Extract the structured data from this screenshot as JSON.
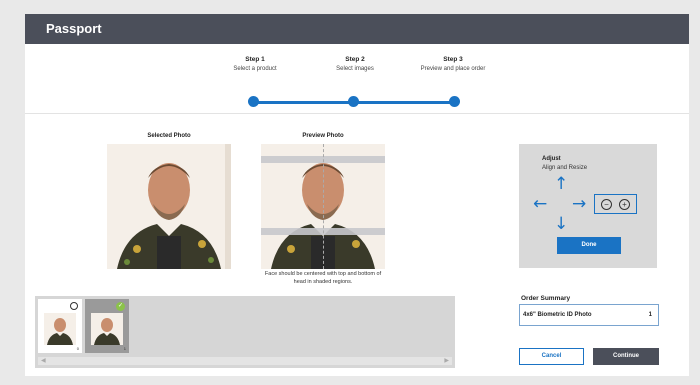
{
  "header": {
    "title": "Passport"
  },
  "steps": [
    {
      "number": "Step 1",
      "description": "Select a product"
    },
    {
      "number": "Step 2",
      "description": "Select images"
    },
    {
      "number": "Step 3",
      "description": "Preview and place order"
    }
  ],
  "photos": {
    "selected_title": "Selected Photo",
    "preview_title": "Preview Photo",
    "hint": "Face should be centered with top and bottom of head in shaded regions."
  },
  "thumbnails": [
    {
      "count": "0",
      "selected": false
    },
    {
      "count": "1",
      "selected": true
    }
  ],
  "adjust": {
    "title": "Adjust",
    "subtitle": "Align and Resize",
    "done_label": "Done",
    "zoom_out_symbol": "−",
    "zoom_in_symbol": "+",
    "icons": [
      "arrow-up-icon",
      "arrow-left-icon",
      "arrow-right-icon",
      "arrow-down-icon",
      "zoom-out-icon",
      "zoom-in-icon"
    ]
  },
  "order_summary": {
    "title": "Order Summary",
    "item_label": "4x6\" Biometric ID Photo",
    "item_quantity": "1"
  },
  "actions": {
    "cancel_label": "Cancel",
    "continue_label": "Continue"
  },
  "colors": {
    "header": "#4b4f5a",
    "accent": "#1a73c4",
    "selected_check": "#8bc34a"
  }
}
